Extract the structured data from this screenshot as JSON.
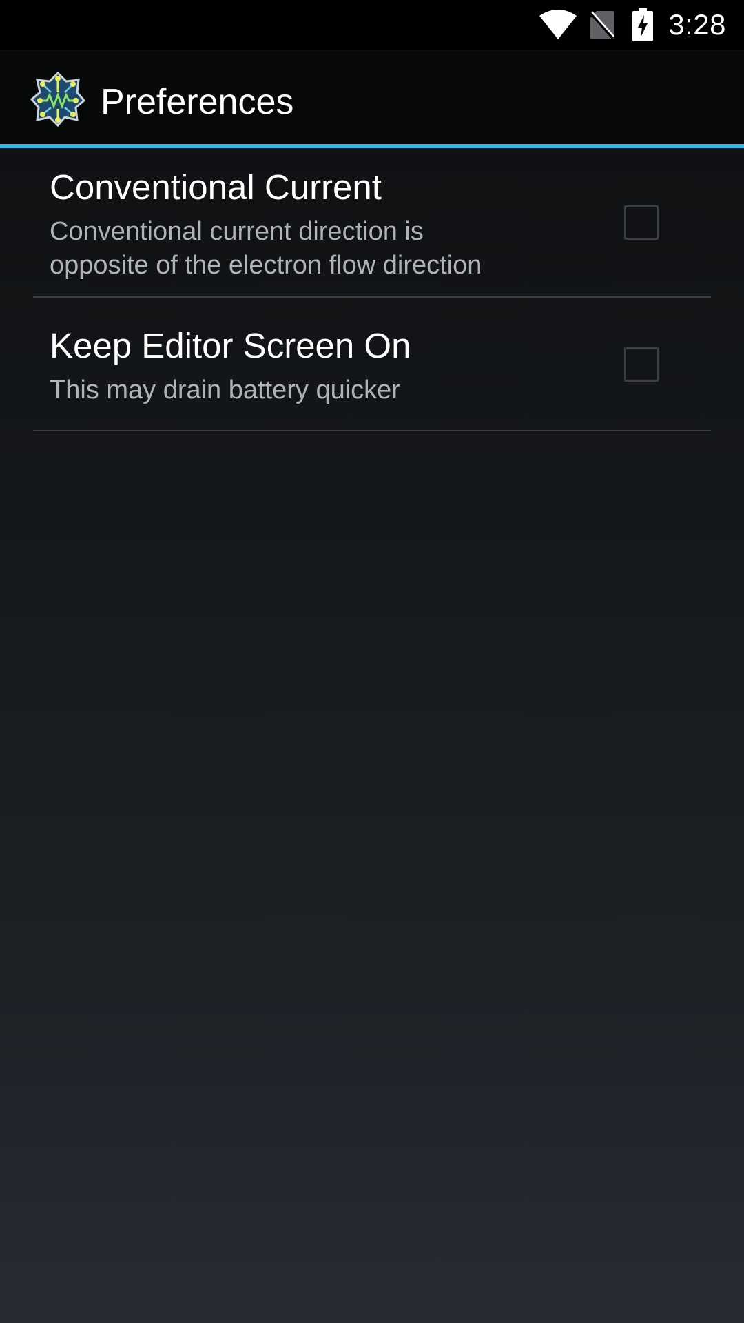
{
  "status_bar": {
    "time": "3:28",
    "icons": [
      "wifi-icon",
      "no-sim-icon",
      "battery-charging-icon"
    ]
  },
  "action_bar": {
    "title": "Preferences",
    "app_icon": "circuit-app-icon",
    "accent_color": "#33b5e5"
  },
  "preferences": [
    {
      "title": "Conventional Current",
      "summary_lines": [
        "Conventional current direction is",
        "opposite of the electron flow direction"
      ],
      "checked": false
    },
    {
      "title": "Keep Editor Screen On",
      "summary_lines": [
        "This may drain battery quicker"
      ],
      "checked": false
    }
  ]
}
